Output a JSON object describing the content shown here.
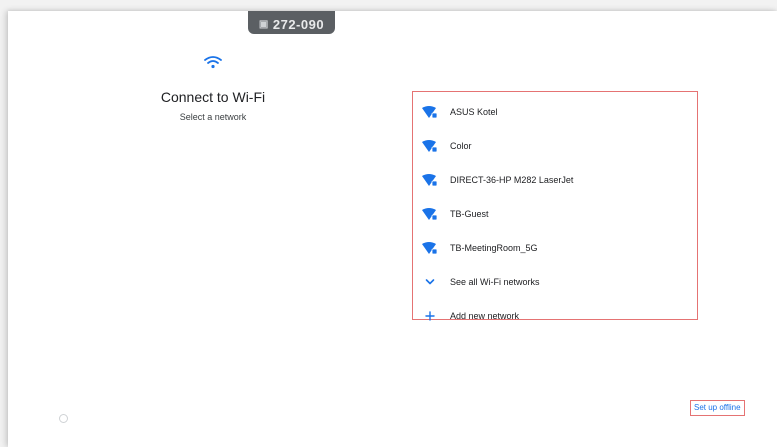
{
  "header": {
    "code_text": "272-090",
    "pill_icon": "device-icon",
    "header_icon": "wifi-icon"
  },
  "title": "Connect to Wi-Fi",
  "subtitle": "Select a network",
  "networks": [
    {
      "name": "ASUS Kotel",
      "icon": "wifi-lock-icon"
    },
    {
      "name": "Color",
      "icon": "wifi-lock-icon"
    },
    {
      "name": "DIRECT-36-HP M282 LaserJet",
      "icon": "wifi-lock-icon"
    },
    {
      "name": "TB-Guest",
      "icon": "wifi-lock-icon"
    },
    {
      "name": "TB-MeetingRoom_5G",
      "icon": "wifi-lock-icon"
    }
  ],
  "actions": {
    "see_all": {
      "label": "See all Wi-Fi networks",
      "icon": "chevron-down-icon"
    },
    "add_new": {
      "label": "Add new network",
      "icon": "plus-icon"
    }
  },
  "footer": {
    "offline_link": "Set up offline"
  },
  "colors": {
    "accent": "#1a73e8",
    "highlight_border": "#e57373"
  }
}
